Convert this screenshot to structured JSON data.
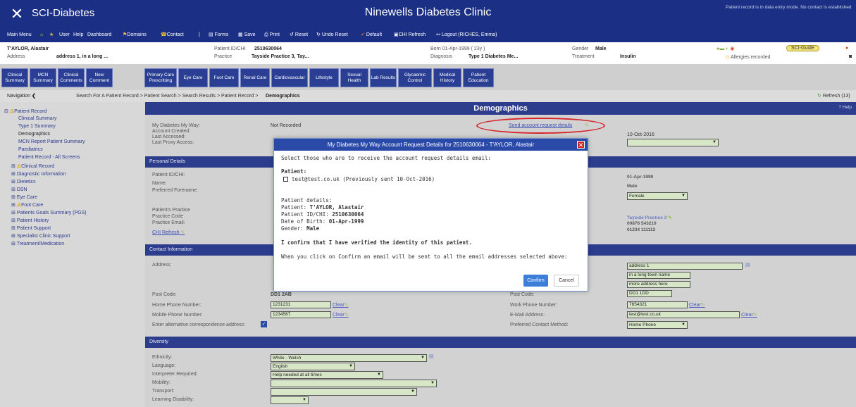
{
  "app": {
    "name": "SCI-Diabetes",
    "clinic": "Ninewells Diabetes Clinic",
    "record_notice": "Patient record is in data entry mode. No contact is established"
  },
  "menu": {
    "items": [
      "Main Menu",
      "User",
      "Help",
      "Dashboard",
      "Domains",
      "Contact",
      "Forms",
      "Save",
      "Print",
      "Reset",
      "Undo Reset",
      "Default",
      "CHI Refresh",
      "Logout (RICHES, Emma)"
    ]
  },
  "patient": {
    "name": "T'AYLOR, Alastair",
    "address_label": "Address",
    "address": "address 1, in a long ...",
    "id_label": "Patient ID/CHI",
    "id": "2510630064",
    "practice_label": "Practice",
    "practice": "Tayside Practice 3, Tay...",
    "born": "Born  01-Apr-1999 ( 23y )",
    "diagnosis_label": "Diagnosis",
    "diagnosis": "Type 1 Diabetes Me...",
    "gender_label": "Gender",
    "gender": "Male",
    "treatment_label": "Treatment",
    "treatment": "Insulin",
    "allergies": "Allergies recorded",
    "sci_guide": "SCI-Guide"
  },
  "tabs": [
    "Clinical Summary",
    "MCN Summary",
    "Clinical Comments",
    "New Comment",
    "Primary Care Prescribing",
    "Eye Care",
    "Foot Care",
    "Renal Care",
    "Cardiovascular",
    "Lifestyle",
    "Sexual Health",
    "Lab Results",
    "Glycaemic Control",
    "Medical History",
    "Patient Education"
  ],
  "breadcrumb": {
    "nav_label": "Navigation",
    "path": "Search For A Patient Record > Patient Search > Search Results > Patient Record > ",
    "current": "Demographics",
    "refresh": "Refresh (13)"
  },
  "sidebar": {
    "items": [
      "Patient Record",
      "Clinical Summary",
      "Type 1 Summary",
      "Demographics",
      "MCN Report Patient Summary",
      "Paediatrics",
      "Patient Record - All Screens",
      "Clinical Record",
      "Diagnostic Information",
      "Dietetics",
      "DSN",
      "Eye Care",
      "Foot Care",
      "Patients Goals Summary (PGS)",
      "Patient History",
      "Patient Support",
      "Specialist Clinic Support",
      "Treatment/Medication"
    ]
  },
  "demographics": {
    "title": "Demographics",
    "help": "Help",
    "mdmw_label": "My Diabetes My Way:",
    "mdmw_value": "Not Recorded",
    "account_created": "Account Created:",
    "last_accessed": "Last Accessed:",
    "last_proxy": "Last Proxy Access:",
    "send_link": "Send account request details",
    "date_right": "10-Oct-2016",
    "personal_details": "Personal Details",
    "pid_label": "Patient ID/CHI:",
    "name_label": "Name:",
    "pref_forename": "Preferred Forename:",
    "dob_value": "01-Apr-1999",
    "gender_value": "Male",
    "gender_select": "Female",
    "practice_label": "Patient's Practice",
    "practice_code": "Practice Code",
    "practice_email": "Practice Email:",
    "chi_refresh": "CHI Refresh",
    "practice_value": "Tayside Practice 3",
    "practice_phone1": "00876 543210",
    "practice_phone2": "01234 111112",
    "contact_info": "Contact Information",
    "address_label": "Address:",
    "addr1": "address 1",
    "addr2": "in a long town name",
    "addr3": "more address here",
    "post_code_label": "Post Code:",
    "post_code": "DD1 2AB",
    "post_code_right": "DD1 1DD",
    "home_phone_label": "Home Phone Number:",
    "home_phone": "1231231",
    "work_phone_label": "Work Phone Number:",
    "work_phone": "7654321",
    "mobile_label": "Mobile Phone Number:",
    "mobile": "1234567",
    "email_label": "E-Mail Address:",
    "email": "test@test.co.uk",
    "alt_address_label": "Enter alternative correspondence address:",
    "pref_contact_label": "Preferred Contact Method:",
    "pref_contact": "Home Phone",
    "clear": "Clear",
    "diversity": "Diversity",
    "ethnicity_label": "Ethnicity:",
    "ethnicity": "White - Welsh",
    "language_label": "Language:",
    "language": "English",
    "interpreter_label": "Interpreter Required:",
    "interpreter": "Help needed at all times",
    "mobility_label": "Mobility:",
    "transport_label": "Transport:",
    "ld_label": "Learning Disability:"
  },
  "dialog": {
    "title": "My Diabetes My Way Account Request Details for 2510630064 - T'AYLOR, Alastair",
    "intro": "Select those who are to receive the account request details email:",
    "patient_heading": "Patient:",
    "option": "test@test.co.uk (Previously sent 10-Oct-2016)",
    "details_heading": "Patient details:",
    "detail_patient_label": "Patient:",
    "detail_patient": "T'AYLOR, Alastair",
    "detail_id_label": "Patient ID/CHI:",
    "detail_id": "2510630064",
    "detail_dob_label": "Date of Birth:",
    "detail_dob": "01-Apr-1999",
    "detail_gender_label": "Gender:",
    "detail_gender": "Male",
    "verify": "I confirm that I have verified the identity of this patient.",
    "notice": "When you click on Confirm an email will be sent to all the email addresses selected above:",
    "confirm": "Confirm",
    "cancel": "Cancel"
  },
  "colors": {
    "header": "#1b2f84",
    "section": "#2d3d8e",
    "field": "#d8e6c8",
    "highlight_oval": "#d7262b",
    "confirm": "#3d7fd8"
  }
}
